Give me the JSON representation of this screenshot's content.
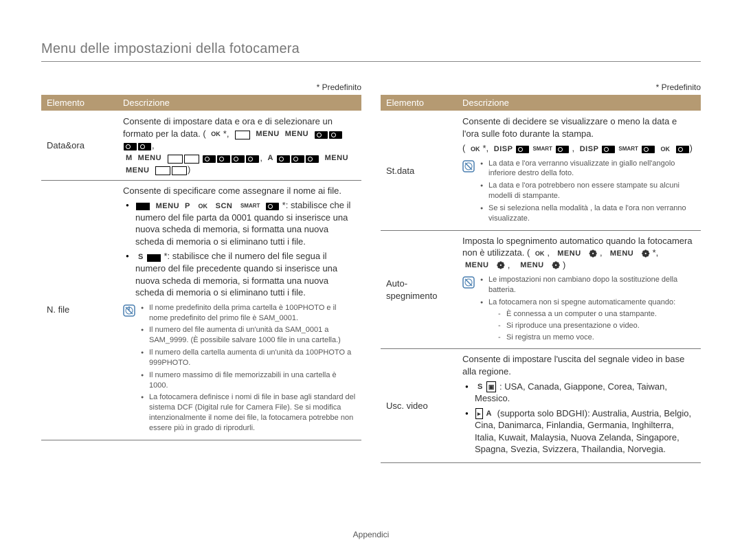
{
  "page_title": "Menu delle impostazioni della fotocamera",
  "predefinito": "* Predefinito",
  "headers": {
    "elemento": "Elemento",
    "descrizione": "Descrizione"
  },
  "footer": "Appendici",
  "left": {
    "row1": {
      "name": "Data&ora",
      "desc": "Consente di impostare data e ora e di selezionare un formato per la data. ("
    },
    "row2": {
      "name": "N. file",
      "lead": "Consente di specificare come assegnare il nome ai file.",
      "bullet1_tail": "*: stabilisce che il numero del file parta da 0001 quando si inserisce una nuova scheda di memoria, si formatta una nuova scheda di memoria o si eliminano tutti i file.",
      "bullet2_tail": "*: stabilisce che il numero del file segua il numero del file precedente quando si inserisce una nuova scheda di memoria, si formatta una nuova scheda di memoria o si eliminano tutti i file.",
      "notes": [
        "Il nome predefinito della prima cartella è 100PHOTO e il nome predefinito del primo file è SAM_0001.",
        "Il numero del file aumenta di un'unità da SAM_0001 a SAM_9999. (È possibile salvare 1000 file in una cartella.)",
        "Il numero della cartella aumenta di un'unità da 100PHOTO a 999PHOTO.",
        "Il numero massimo di file memorizzabili in una cartella è 1000.",
        "La fotocamera definisce i nomi di file in base agli standard del sistema DCF (Digital rule for Camera File). Se si modifica intenzionalmente il nome dei file, la fotocamera potrebbe non essere più in grado di riprodurli."
      ]
    }
  },
  "right": {
    "row1": {
      "name": "St.data",
      "desc": "Consente di decidere se visualizzare o meno la data e l'ora sulle foto durante la stampa.",
      "notes": [
        "La data e l'ora verranno visualizzate in giallo nell'angolo inferiore destro della foto.",
        "La data e l'ora potrebbero non essere stampate su alcuni modelli di stampante.",
        "Se si seleziona           nella modalità        , la data e l'ora non verranno visualizzate."
      ]
    },
    "row2": {
      "name": "Auto-spegnimento",
      "desc": "Imposta lo spegnimento automatico quando la fotocamera non è utilizzata. (",
      "notes_lead": "Le impostazioni non cambiano dopo la sostituzione della batteria.",
      "notes_item2": "La fotocamera non si spegne automaticamente quando:",
      "dash": [
        "È connessa a un computer o una stampante.",
        "Si riproduce una presentazione o video.",
        "Si registra un memo voce."
      ]
    },
    "row3": {
      "name": "Usc. video",
      "lead": "Consente di impostare l'uscita del segnale video in base alla regione.",
      "b1": ": USA, Canada, Giappone, Corea, Taiwan, Messico.",
      "b2": " (supporta solo BDGHI): Australia, Austria, Belgio, Cina, Danimarca, Finlandia, Germania, Inghilterra, Italia, Kuwait, Malaysia, Nuova Zelanda, Singapore, Spagna, Svezia, Svizzera, Thailandia, Norvegia."
    }
  },
  "glyph_labels": {
    "menu": "MENU",
    "scn": "SCN",
    "smart": "SMART",
    "disp": "DISP",
    "ok": "OK",
    "M": "M",
    "A": "A",
    "S": "S",
    "P": "P"
  }
}
